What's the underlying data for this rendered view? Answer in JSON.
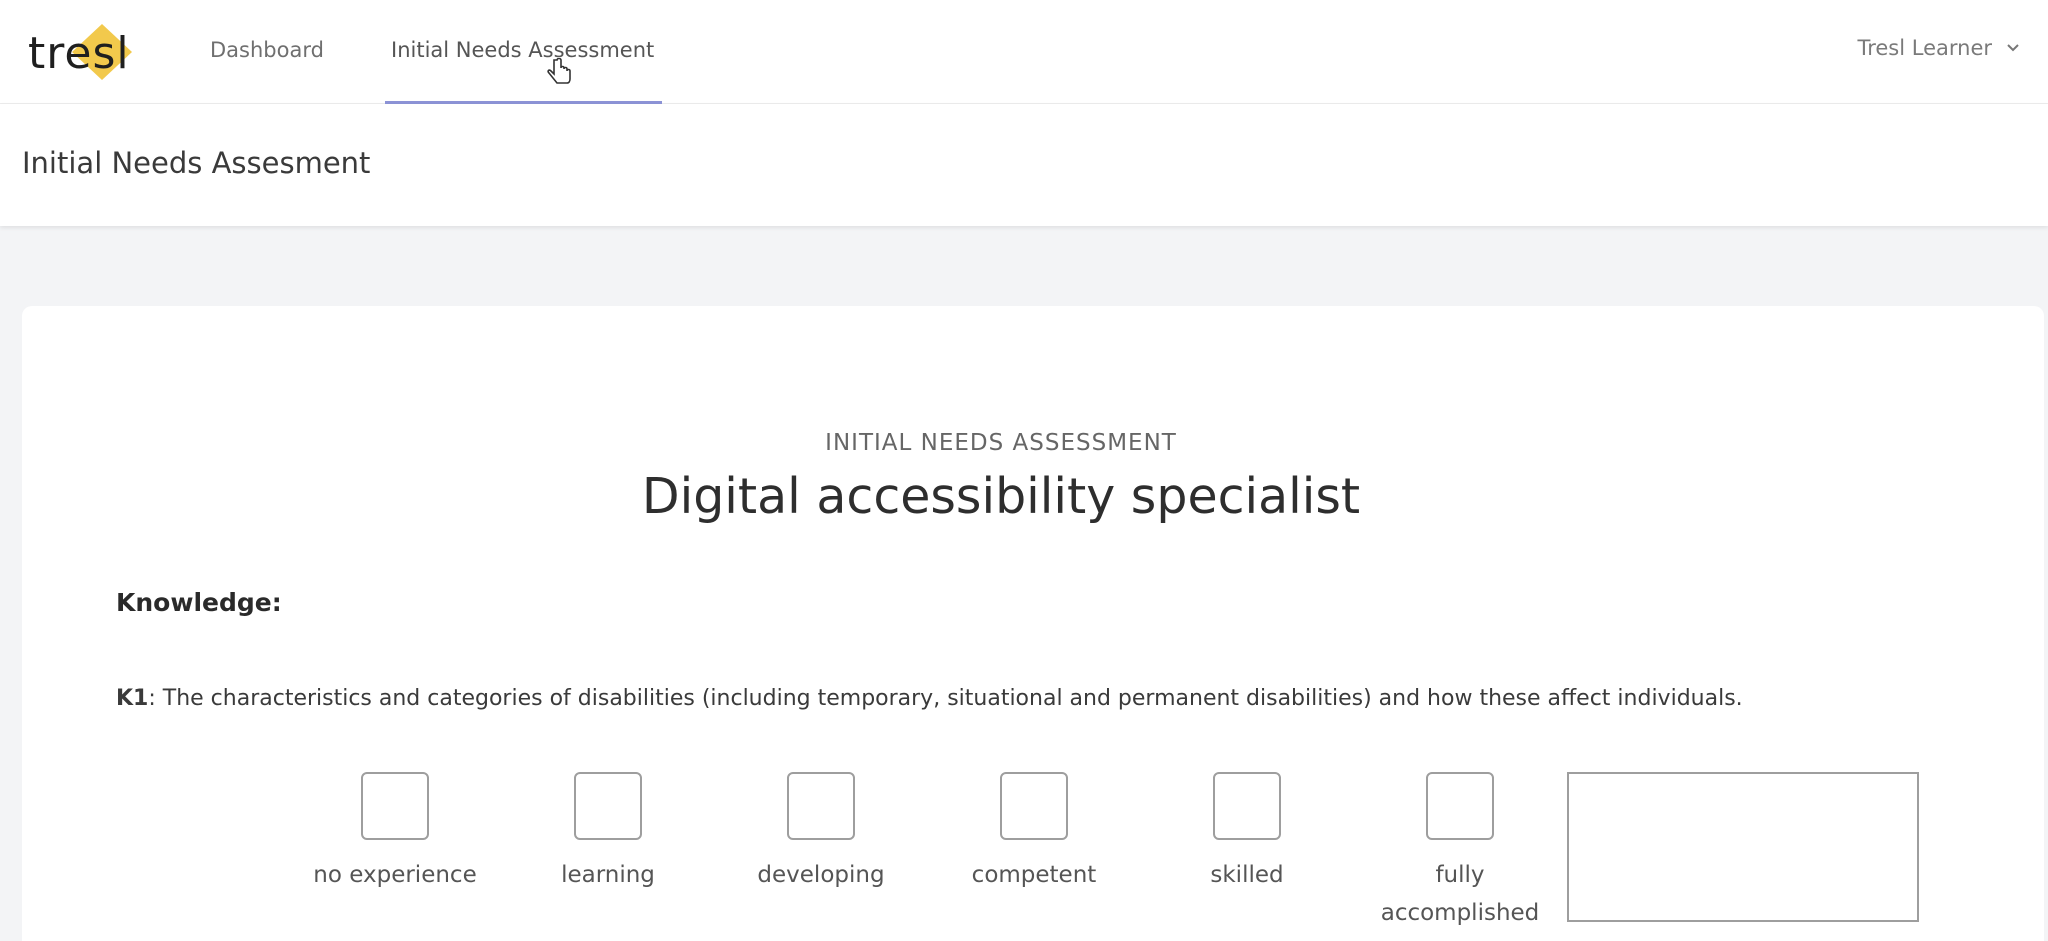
{
  "brand": {
    "logo_text": "tresl",
    "accent": "#f2c94c"
  },
  "nav": {
    "links": [
      {
        "label": "Dashboard"
      },
      {
        "label": "Initial Needs Assessment",
        "active": true
      }
    ],
    "user": {
      "name": "Tresl Learner",
      "icon": "chevron-down-icon"
    }
  },
  "page": {
    "title": "Initial Needs Assesment"
  },
  "card": {
    "eyebrow": "INITIAL NEEDS ASSESSMENT",
    "heading": "Digital accessibility specialist",
    "section": "Knowledge:",
    "question": {
      "code": "K1",
      "text": ": The characteristics and categories of disabilities (including temporary, situational and permanent disabilities) and how these affect individuals."
    },
    "options": [
      "no experience",
      "learning",
      "developing",
      "competent",
      "skilled",
      "fully accomplished"
    ],
    "notes_value": ""
  }
}
